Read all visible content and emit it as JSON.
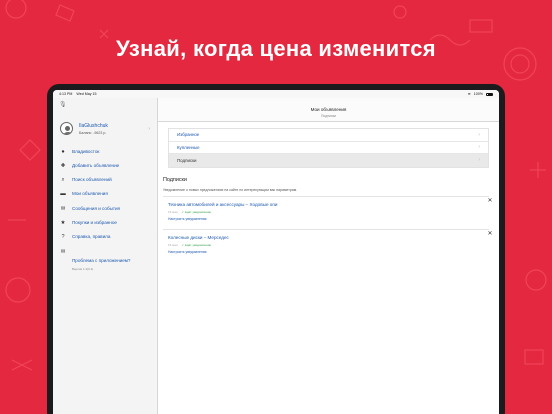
{
  "banner": {
    "headline": "Узнай, когда цена изменится"
  },
  "colors": {
    "background": "#e3283f",
    "link": "#1b57b0",
    "success": "#2f9e44"
  },
  "statusbar": {
    "time": "4:13 PM",
    "date": "Wed May 15",
    "battery": "100%"
  },
  "profile": {
    "username": "IlaGlushchuk",
    "balance": "Баланс: -9623 р.",
    "icon": "user-avatar-icon"
  },
  "menu": [
    {
      "label": "Владивосток",
      "icon": "location-pin-icon",
      "sub": ""
    },
    {
      "label": "Добавить объявление",
      "icon": "plus-icon",
      "sub": ""
    },
    {
      "label": "Поиск объявлений",
      "icon": "search-icon",
      "sub": ""
    },
    {
      "label": "Мои объявления",
      "icon": "folder-icon",
      "sub": ""
    },
    {
      "label": "Сообщения и события",
      "icon": "message-icon",
      "sub": ""
    },
    {
      "label": "Покупки и избранное",
      "icon": "star-icon",
      "sub": ""
    },
    {
      "label": "Справка, правила",
      "icon": "help-icon",
      "sub": ""
    },
    {
      "label": "Проблема с приложением?",
      "icon": "mail-icon",
      "sub": "Версия 1.2(0.2)"
    }
  ],
  "navbar": {
    "title": "Мои объявления",
    "subtitle": "Подписки"
  },
  "tabs": [
    {
      "label": "Избранное",
      "active": false
    },
    {
      "label": "Купленные",
      "active": false
    },
    {
      "label": "Подписки",
      "active": true
    }
  ],
  "section": {
    "title": "Подписки",
    "description": "Уведомление о новых предложениях на сайте по интересующим вас параметрам."
  },
  "subscriptions": [
    {
      "title": "Техника автомобилей и аксессуары – Ходовые опи",
      "date": "15 мая",
      "status": "✓ ждёт уведомление",
      "link": "Настроить уведомления"
    },
    {
      "title": "Колесные диски – Мерседес",
      "date": "15 мая",
      "status": "✓ ждёт уведомление",
      "link": "Настроить уведомления"
    }
  ]
}
